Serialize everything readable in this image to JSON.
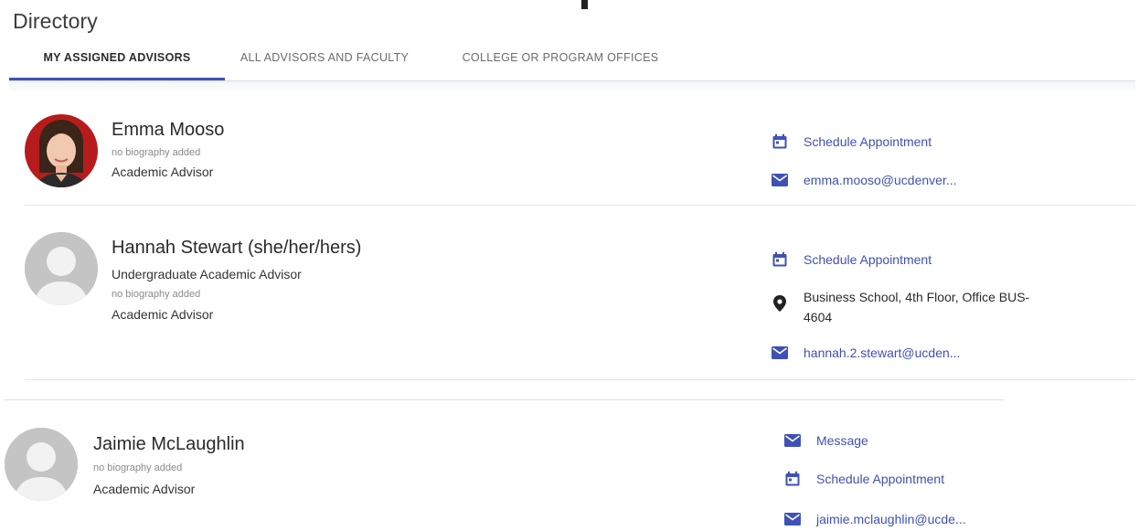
{
  "page": {
    "title": "Directory"
  },
  "tabs": [
    {
      "label": "MY ASSIGNED ADVISORS",
      "active": true
    },
    {
      "label": "ALL ADVISORS AND FACULTY",
      "active": false
    },
    {
      "label": "COLLEGE OR PROGRAM OFFICES",
      "active": false
    }
  ],
  "colors": {
    "accent": "#3f51b5",
    "avatar_placeholder": "#c4c4c4",
    "photo_bg": "#b71c1c"
  },
  "advisors": [
    {
      "name": "Emma Mooso",
      "subtitle": "",
      "bio": "no biography added",
      "role": "Academic Advisor",
      "avatar": "photo",
      "actions": [
        {
          "icon": "calendar-icon",
          "label": "Schedule Appointment"
        },
        {
          "icon": "mail-icon",
          "label": "emma.mooso@ucdenver..."
        }
      ]
    },
    {
      "name": "Hannah Stewart (she/her/hers)",
      "subtitle": "Undergraduate Academic Advisor",
      "bio": "no biography added",
      "role": "Academic Advisor",
      "avatar": "placeholder",
      "actions": [
        {
          "icon": "calendar-icon",
          "label": "Schedule Appointment"
        },
        {
          "icon": "location-pin-icon",
          "label": "Business School, 4th Floor, Office BUS-4604"
        },
        {
          "icon": "mail-icon",
          "label": "hannah.2.stewart@ucden..."
        }
      ]
    },
    {
      "name": "Jaimie McLaughlin",
      "subtitle": "",
      "bio": "no biography added",
      "role": "Academic Advisor",
      "avatar": "placeholder",
      "actions": [
        {
          "icon": "mail-icon",
          "label": "Message"
        },
        {
          "icon": "calendar-icon",
          "label": "Schedule Appointment"
        },
        {
          "icon": "mail-icon",
          "label": "jaimie.mclaughlin@ucde..."
        }
      ]
    }
  ]
}
